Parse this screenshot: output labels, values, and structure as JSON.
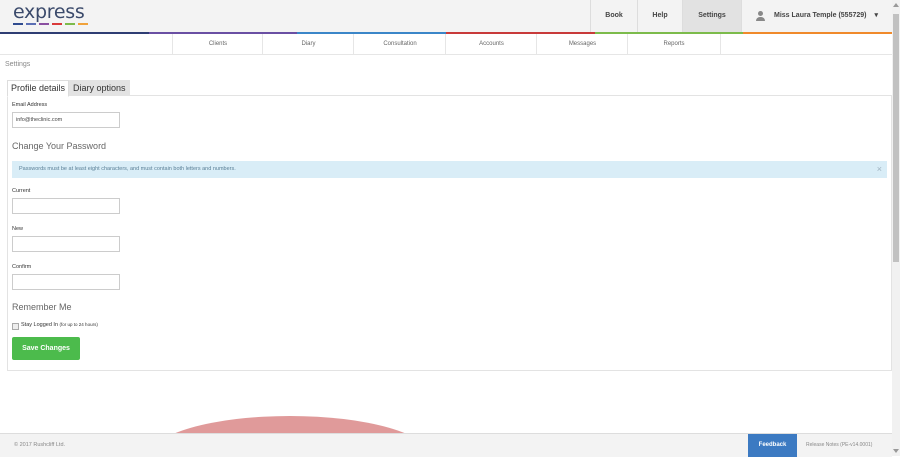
{
  "app": {
    "logo_text": "express",
    "logo_bar_colors": [
      "#2f4b8f",
      "#5b6fb4",
      "#8a4fa0",
      "#d93a3a",
      "#7cbb4b",
      "#f0a23b"
    ]
  },
  "topnav": {
    "book": "Book",
    "help": "Help",
    "settings": "Settings",
    "user": "Miss Laura Temple (555729)",
    "caret": "▾"
  },
  "colorline": [
    "#2e3d73",
    "#6a4fa3",
    "#3b86c8",
    "#c83a3a",
    "#7cbb4b",
    "#f08a2b"
  ],
  "subnav": {
    "tabs": [
      "Clients",
      "Diary",
      "Consultation",
      "Accounts",
      "Messages",
      "Reports"
    ]
  },
  "page": {
    "label": "Settings",
    "tabs": [
      "Profile details",
      "Diary options"
    ]
  },
  "form": {
    "email_label": "Email Address",
    "email_value": "info@theclinic.com",
    "password_heading": "Change Your Password",
    "password_alert": "Passwords must be at least eight characters, and must contain both letters and numbers.",
    "alert_close": "×",
    "current_label": "Current",
    "new_label": "New",
    "confirm_label": "Confirm",
    "remember_heading": "Remember Me",
    "stay_logged_in": "Stay Logged In",
    "stay_logged_in_note": "(for up to 24 hours)",
    "save_label": "Save Changes"
  },
  "footer": {
    "copyright": "© 2017 Rushcliff Ltd.",
    "feedback": "Feedback",
    "release_notes": "Release Notes (PE-v14.0001)"
  },
  "colors": {
    "primary_green": "#4cbb4c",
    "feedback_blue": "#3c7ac2",
    "alert_bg": "#d9edf7",
    "decor_blob": "#e09a9a"
  }
}
